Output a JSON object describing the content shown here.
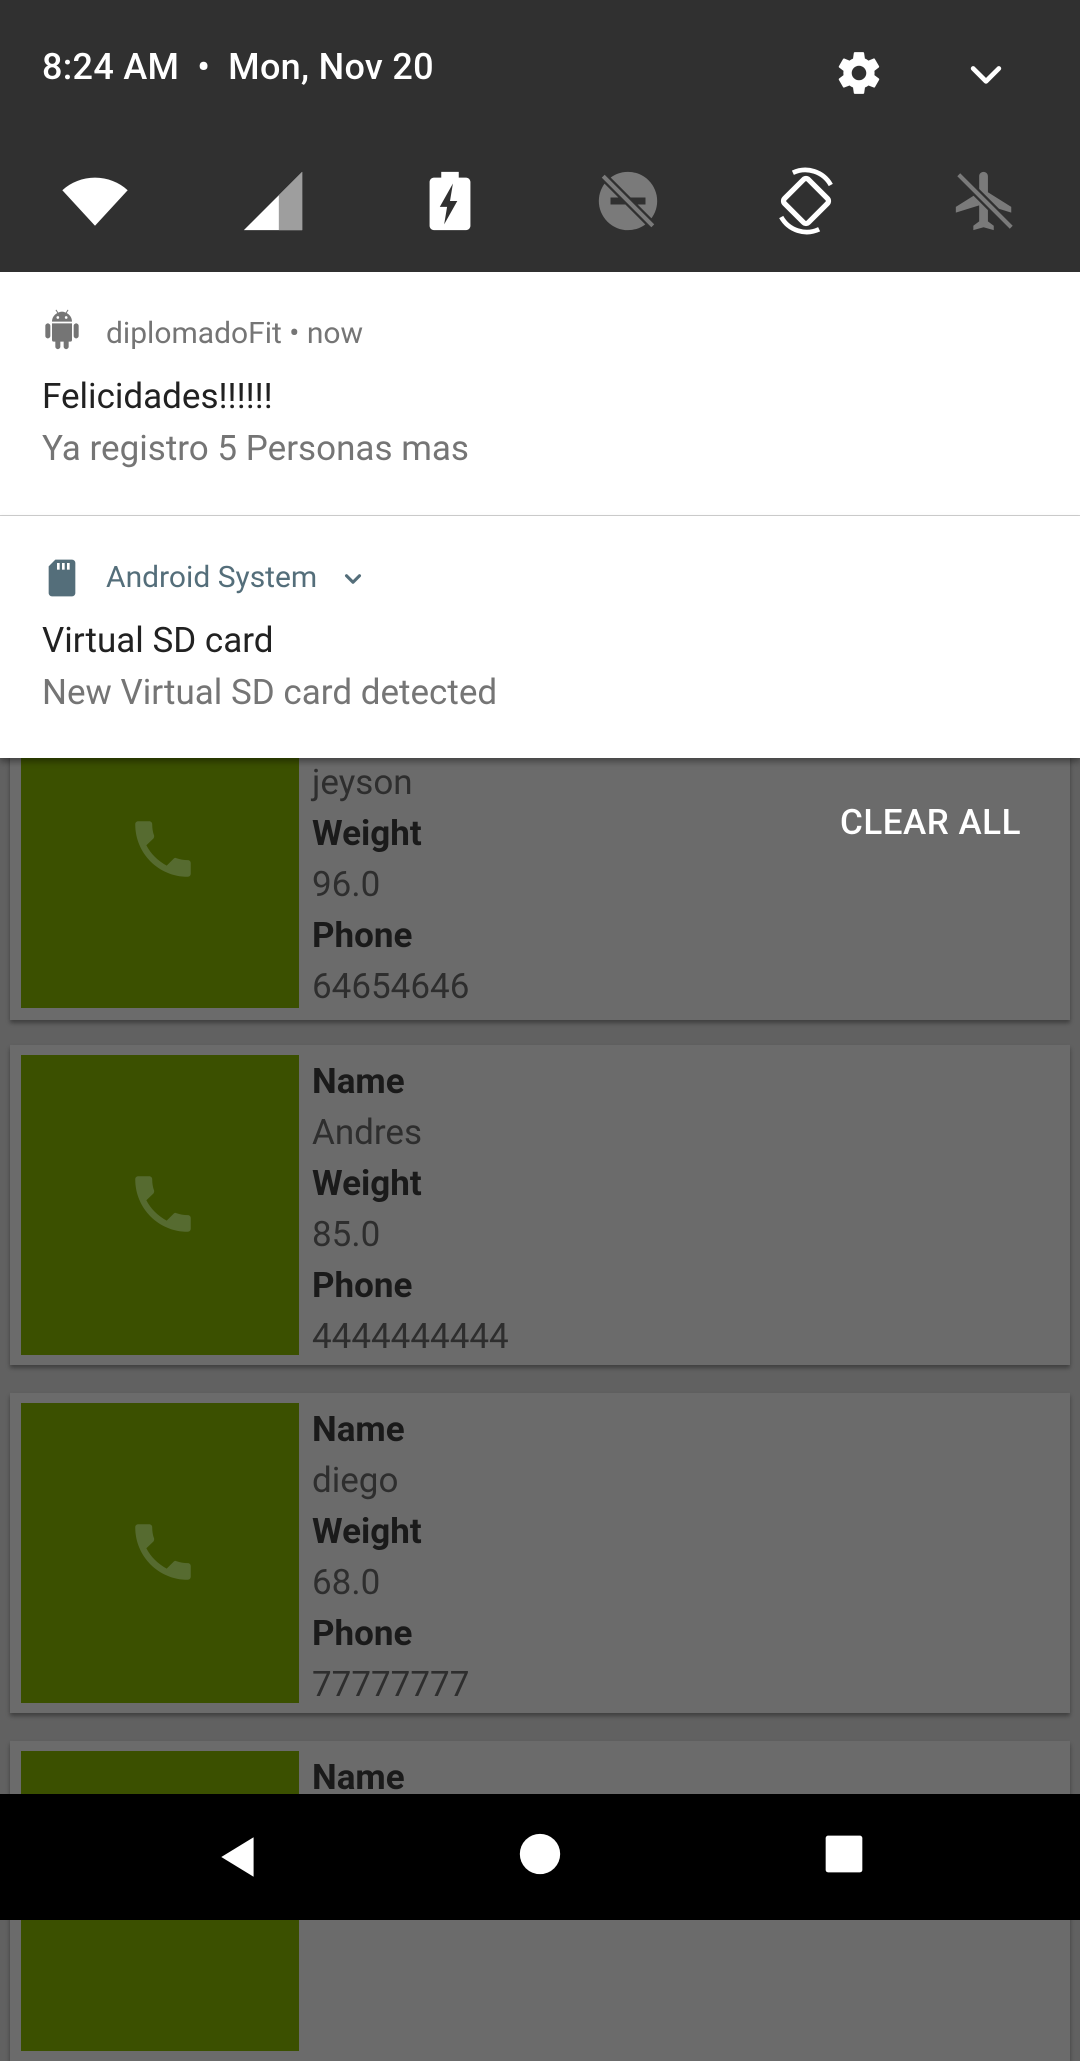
{
  "status": {
    "time": "8:24 AM",
    "separator": "•",
    "date": "Mon, Nov 20"
  },
  "quick_settings": {
    "header_icons": [
      "settings-gear-icon",
      "expand-chevron-icon"
    ],
    "tiles": [
      "wifi-icon",
      "cellular-signal-icon",
      "battery-charging-icon",
      "do-not-disturb-off-icon",
      "auto-rotate-icon",
      "airplane-mode-icon"
    ]
  },
  "notifications": [
    {
      "app": "diplomadoFit",
      "meta": "• now",
      "title": "Felicidades!!!!!!",
      "text": "Ya registro 5 Personas mas",
      "icon": "android-icon"
    },
    {
      "app": "Android System",
      "title": "Virtual SD card",
      "text": "New Virtual SD card detected",
      "icon": "sd-card-icon",
      "accent": "#546e7a"
    }
  ],
  "clear_all": "CLEAR ALL",
  "list": {
    "cards": [
      {
        "name_label": "",
        "name": "jeyson",
        "weight_label": "Weight",
        "weight": "96.0",
        "phone_label": "Phone",
        "phone": "64654646"
      },
      {
        "name_label": "Name",
        "name": "Andres",
        "weight_label": "Weight",
        "weight": "85.0",
        "phone_label": "Phone",
        "phone": "4444444444"
      },
      {
        "name_label": "Name",
        "name": "diego",
        "weight_label": "Weight",
        "weight": "68.0",
        "phone_label": "Phone",
        "phone": "77777777"
      },
      {
        "name_label": "Name"
      }
    ],
    "thumb_color": "#3b5000"
  },
  "navbar": {
    "icons": [
      "back-icon",
      "home-icon",
      "recents-icon"
    ]
  }
}
